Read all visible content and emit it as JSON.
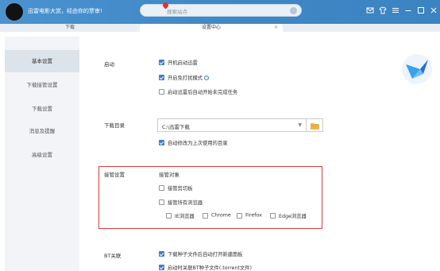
{
  "titlebar": {
    "slogan": "迅雷电影大赏，经由你的票审!",
    "search_placeholder": "搜索站点"
  },
  "tabs": [
    {
      "label": "下载"
    },
    {
      "label": "设置中心"
    }
  ],
  "tab_close": "×",
  "sidebar": {
    "items": [
      {
        "label": "基本设置",
        "active": true
      },
      {
        "label": "下载接管设置"
      },
      {
        "label": "下载设置"
      },
      {
        "label": "消息及提醒"
      },
      {
        "label": "高级设置"
      }
    ]
  },
  "startup": {
    "label": "启动",
    "options": [
      {
        "label": "开机启动迅雷",
        "checked": true
      },
      {
        "label": "开启免打扰模式",
        "checked": true
      },
      {
        "label": "启动迅雷后自动开始未完成任务",
        "checked": false
      }
    ],
    "info_glyph": "i"
  },
  "download_dir": {
    "label": "下载目录",
    "value": "C:\\迅雷下载",
    "auto_change": {
      "label": "自动修改为上次使用的目录",
      "checked": true
    }
  },
  "takeover": {
    "label": "接管设置",
    "subtitle": "接管对象",
    "clipboard": {
      "label": "接管剪切板",
      "checked": false
    },
    "browsers": {
      "label": "接管所有浏览器",
      "checked": false
    },
    "browser_list": [
      {
        "label": "IE浏览器",
        "checked": false
      },
      {
        "label": "Chrome",
        "checked": false
      },
      {
        "label": "Firefox",
        "checked": false
      },
      {
        "label": "Edge浏览器",
        "checked": false
      }
    ]
  },
  "bt": {
    "label": "BT关联",
    "options": [
      {
        "label": "下载种子文件后自动打开新建面板",
        "checked": true
      },
      {
        "label": "启动时关联BT种子文件(.torrent文件)",
        "checked": true
      }
    ]
  },
  "colors": {
    "titlebar": "#3f87c6",
    "accent": "#3c7dd1",
    "highlight_border": "#e03a3a"
  }
}
